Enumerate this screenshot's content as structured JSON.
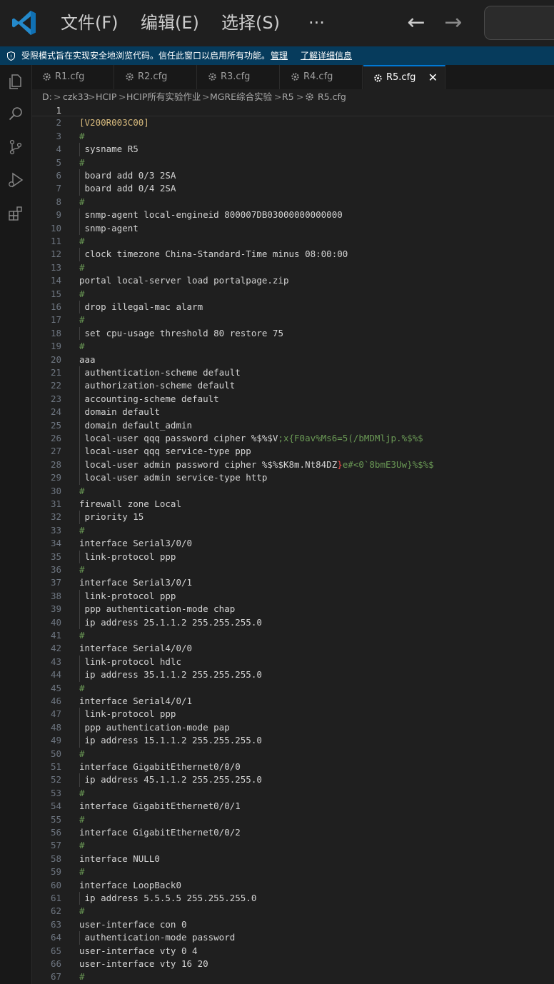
{
  "menu": {
    "file": "文件(F)",
    "edit": "编辑(E)",
    "select": "选择(S)",
    "more": "···"
  },
  "nav": {
    "back": "←",
    "forward": "→"
  },
  "banner": {
    "message": "受限模式旨在实现安全地浏览代码。信任此窗口以启用所有功能。",
    "manage": "管理",
    "learn_more": "了解详细信息"
  },
  "tabs": [
    {
      "label": "R1.cfg"
    },
    {
      "label": "R2.cfg"
    },
    {
      "label": "R3.cfg"
    },
    {
      "label": "R4.cfg"
    },
    {
      "label": "R5.cfg",
      "active": true,
      "close": "✕"
    }
  ],
  "breadcrumb": [
    "D:",
    "czk33",
    "HCIP",
    "HCIP所有实验作业",
    "MGRE综合实验",
    "R5",
    "R5.cfg"
  ],
  "colors": {
    "accent": "#0078d4",
    "banner_bg": "#063b5c",
    "comment_green": "#6a9955",
    "version_yellow": "#d7ba7d",
    "error_red": "#f44747",
    "logo_blue": "#2489ca"
  },
  "icons": {
    "activity": [
      "explorer-icon",
      "search-icon",
      "source-control-icon",
      "run-debug-icon",
      "extensions-icon"
    ],
    "file": "gear-icon"
  },
  "editor": {
    "current_line": 1,
    "lines": [
      "",
      "[V200R003C00]",
      "#",
      " sysname R5",
      "#",
      " board add 0/3 2SA",
      " board add 0/4 2SA",
      "#",
      " snmp-agent local-engineid 800007DB03000000000000",
      " snmp-agent",
      "#",
      " clock timezone China-Standard-Time minus 08:00:00",
      "#",
      "portal local-server load portalpage.zip",
      "#",
      " drop illegal-mac alarm",
      "#",
      " set cpu-usage threshold 80 restore 75",
      "#",
      "aaa",
      " authentication-scheme default",
      " authorization-scheme default",
      " accounting-scheme default",
      " domain default",
      " domain default_admin",
      " local-user qqq password cipher %$%$V;x{F0av%Ms6=5(/bMDMljp.%$%$",
      " local-user qqq service-type ppp",
      " local-user admin password cipher %$%$K8m.Nt84DZ}e#<0`8bmE3Uw}%$%$",
      " local-user admin service-type http",
      "#",
      "firewall zone Local",
      " priority 15",
      "#",
      "interface Serial3/0/0",
      " link-protocol ppp",
      "#",
      "interface Serial3/0/1",
      " link-protocol ppp",
      " ppp authentication-mode chap",
      " ip address 25.1.1.2 255.255.255.0",
      "#",
      "interface Serial4/0/0",
      " link-protocol hdlc",
      " ip address 35.1.1.2 255.255.255.0",
      "#",
      "interface Serial4/0/1",
      " link-protocol ppp",
      " ppp authentication-mode pap",
      " ip address 15.1.1.2 255.255.255.0",
      "#",
      "interface GigabitEthernet0/0/0",
      " ip address 45.1.1.2 255.255.255.0",
      "#",
      "interface GigabitEthernet0/0/1",
      "#",
      "interface GigabitEthernet0/0/2",
      "#",
      "interface NULL0",
      "#",
      "interface LoopBack0",
      " ip address 5.5.5.5 255.255.255.0",
      "#",
      "user-interface con 0",
      " authentication-mode password",
      "user-interface vty 0 4",
      "user-interface vty 16 20",
      "#"
    ]
  }
}
